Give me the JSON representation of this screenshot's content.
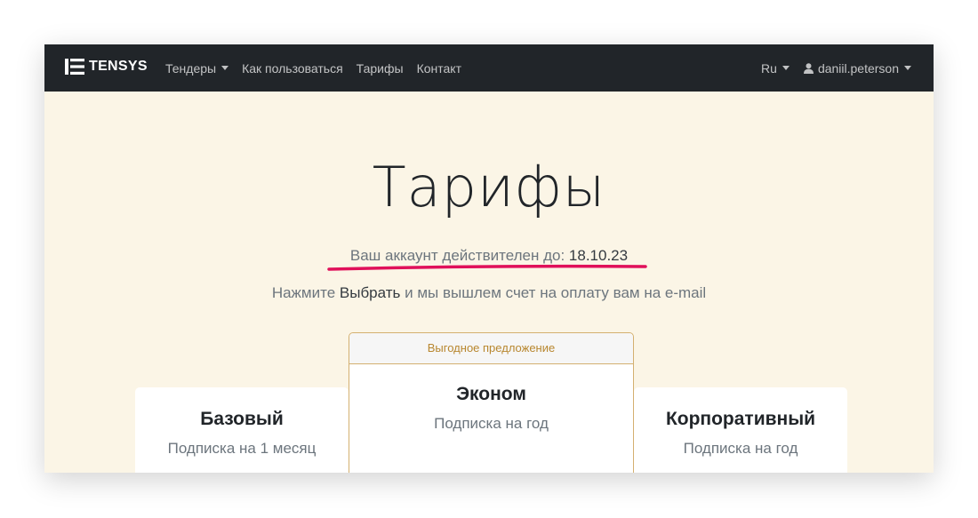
{
  "navbar": {
    "brand": "TENSYS",
    "items": [
      {
        "label": "Тендеры",
        "dropdown": true
      },
      {
        "label": "Как пользоваться",
        "dropdown": false
      },
      {
        "label": "Тарифы",
        "dropdown": false
      },
      {
        "label": "Контакт",
        "dropdown": false
      }
    ],
    "language": "Ru",
    "user": "daniil.peterson"
  },
  "hero": {
    "title": "Тарифы",
    "valid_prefix": "Ваш аккаунт действителен до:",
    "valid_date": "18.10.23",
    "hint_prefix": "Нажмите",
    "hint_bold": "Выбрать",
    "hint_suffix": "и мы вышлем счет на оплату вам на e-mail"
  },
  "plans": [
    {
      "name": "Базовый",
      "subtitle": "Подписка на 1 месяц"
    },
    {
      "name": "Эконом",
      "subtitle": "Подписка на год",
      "badge": "Выгодное предложение"
    },
    {
      "name": "Корпоративный",
      "subtitle": "Подписка на год"
    }
  ],
  "colors": {
    "navbar_bg": "#212529",
    "page_bg": "#fbf5e6",
    "accent_gold": "#b8872f",
    "underline_mark": "#e0105a"
  }
}
